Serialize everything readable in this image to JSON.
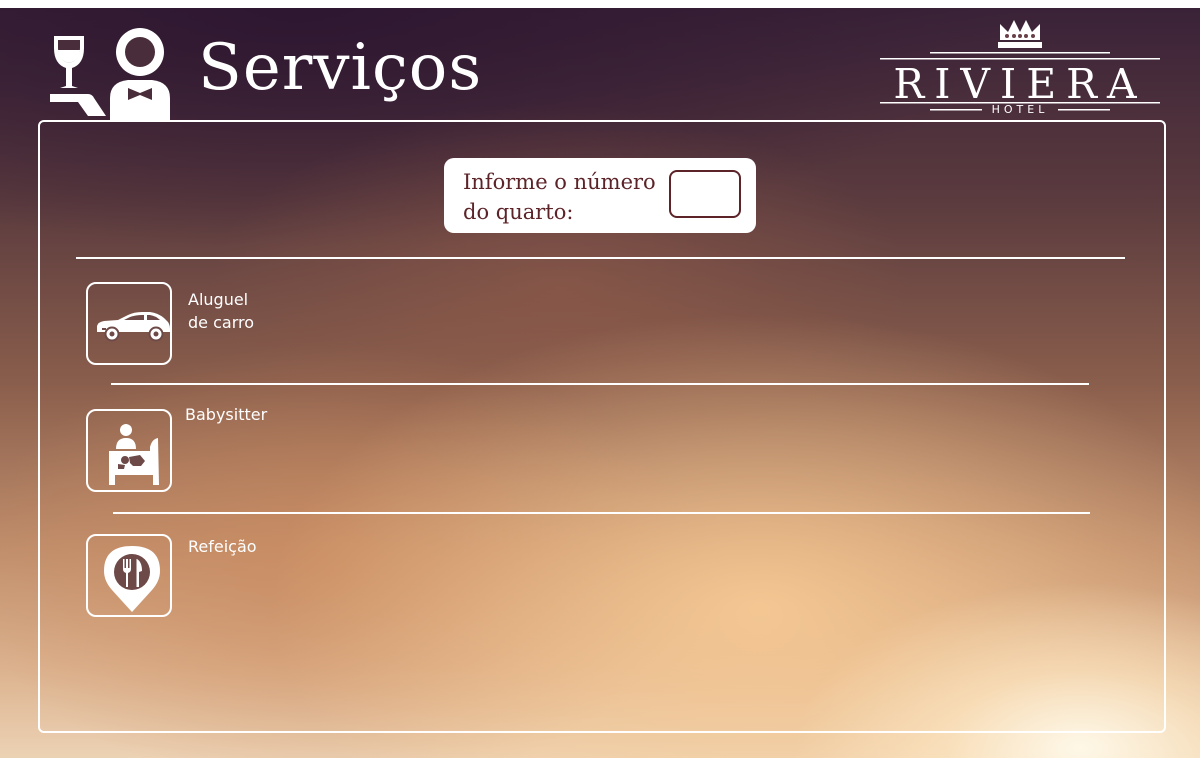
{
  "header": {
    "title": "Serviços",
    "icon": "waiter-icon"
  },
  "logo": {
    "name": "RIVIERA",
    "subtitle": "HOTEL",
    "icon": "crown-icon"
  },
  "room": {
    "label": "Informe o número do quarto:",
    "value": ""
  },
  "services": [
    {
      "label": "Aluguel\nde carro",
      "icon": "car-icon"
    },
    {
      "label": "Babysitter",
      "icon": "babysitter-icon"
    },
    {
      "label": "Refeição",
      "icon": "meal-pin-icon"
    }
  ],
  "colors": {
    "accent": "#5c2328",
    "text": "#ffffff"
  }
}
